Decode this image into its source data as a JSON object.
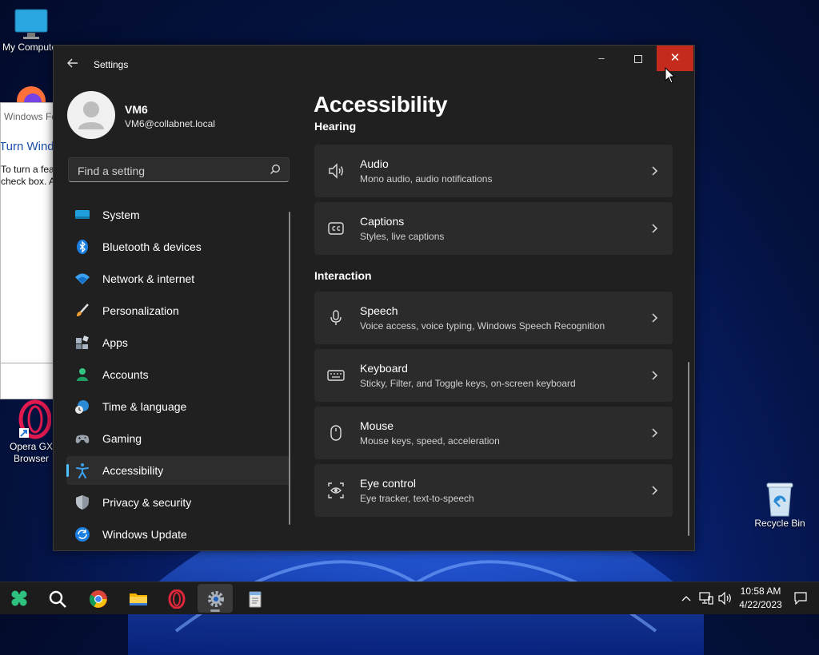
{
  "desktop": {
    "icons": [
      {
        "label": "My Computer"
      },
      {
        "label": "Opera GX Browser"
      },
      {
        "label": "Recycle Bin"
      }
    ],
    "background_window": {
      "title": "Windows Features",
      "heading": "Turn Windows features on or off",
      "text_line1": "To turn a feature on, select its",
      "text_line2": "check box. A filled box means"
    }
  },
  "window": {
    "title": "Settings",
    "controls": {
      "minimize": "–",
      "maximize": "☐",
      "close": "✕"
    }
  },
  "user": {
    "name": "VM6",
    "email": "VM6@collabnet.local"
  },
  "search": {
    "placeholder": "Find a setting"
  },
  "nav": {
    "items": [
      {
        "label": "System",
        "icon": "monitor-icon"
      },
      {
        "label": "Bluetooth & devices",
        "icon": "bluetooth-icon"
      },
      {
        "label": "Network & internet",
        "icon": "wifi-icon"
      },
      {
        "label": "Personalization",
        "icon": "brush-icon"
      },
      {
        "label": "Apps",
        "icon": "apps-icon"
      },
      {
        "label": "Accounts",
        "icon": "person-icon"
      },
      {
        "label": "Time & language",
        "icon": "globe-clock-icon"
      },
      {
        "label": "Gaming",
        "icon": "gamepad-icon"
      },
      {
        "label": "Accessibility",
        "icon": "accessibility-icon",
        "selected": true
      },
      {
        "label": "Privacy & security",
        "icon": "shield-icon"
      },
      {
        "label": "Windows Update",
        "icon": "update-icon"
      }
    ]
  },
  "page": {
    "title": "Accessibility",
    "sections": [
      {
        "heading": "Hearing",
        "cards": [
          {
            "title": "Audio",
            "subtitle": "Mono audio, audio notifications",
            "icon": "speaker-icon"
          },
          {
            "title": "Captions",
            "subtitle": "Styles, live captions",
            "icon": "captions-icon"
          }
        ]
      },
      {
        "heading": "Interaction",
        "cards": [
          {
            "title": "Speech",
            "subtitle": "Voice access, voice typing, Windows Speech Recognition",
            "icon": "microphone-icon"
          },
          {
            "title": "Keyboard",
            "subtitle": "Sticky, Filter, and Toggle keys, on-screen keyboard",
            "icon": "keyboard-icon"
          },
          {
            "title": "Mouse",
            "subtitle": "Mouse keys, speed, acceleration",
            "icon": "mouse-icon"
          },
          {
            "title": "Eye control",
            "subtitle": "Eye tracker, text-to-speech",
            "icon": "eye-control-icon"
          }
        ]
      }
    ]
  },
  "taskbar": {
    "apps": [
      {
        "name": "start-icon"
      },
      {
        "name": "search-icon"
      },
      {
        "name": "chrome-icon"
      },
      {
        "name": "file-explorer-icon"
      },
      {
        "name": "opera-icon"
      },
      {
        "name": "settings-icon",
        "active": true
      },
      {
        "name": "notepad-icon"
      }
    ],
    "clock": {
      "time": "10:58 AM",
      "date": "4/22/2023"
    }
  },
  "colors": {
    "accent": "#4cc2ff",
    "close_button": "#c42b1c",
    "window_bg": "#202020",
    "card_bg": "#2b2b2b"
  }
}
